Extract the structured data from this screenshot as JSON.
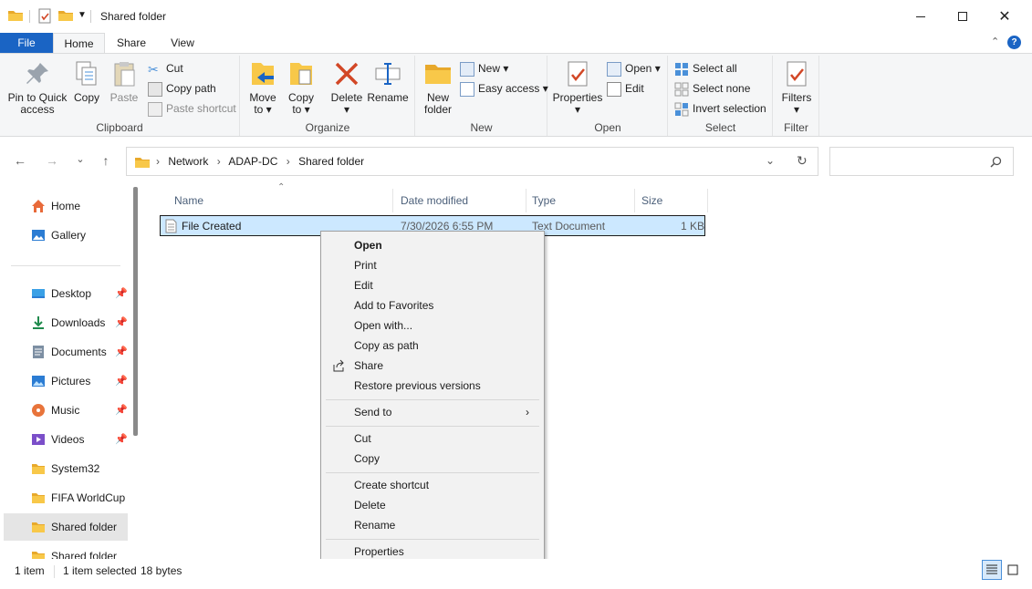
{
  "window": {
    "title": "Shared folder",
    "minimize_icon": "minimize-icon",
    "maximize_icon": "maximize-icon",
    "close_icon": "close-icon"
  },
  "ribbon_tabs": {
    "file": "File",
    "home": "Home",
    "share": "Share",
    "view": "View"
  },
  "ribbon": {
    "clipboard": {
      "label": "Clipboard",
      "pin_line1": "Pin to Quick",
      "pin_line2": "access",
      "copy": "Copy",
      "paste": "Paste",
      "cut": "Cut",
      "copy_path": "Copy path",
      "paste_shortcut": "Paste shortcut"
    },
    "organize": {
      "label": "Organize",
      "move_line1": "Move",
      "move_line2": "to",
      "copy_line1": "Copy",
      "copy_line2": "to",
      "delete": "Delete",
      "rename": "Rename"
    },
    "new": {
      "label": "New",
      "folder_line1": "New",
      "folder_line2": "folder",
      "new_item": "New",
      "easy_access": "Easy access"
    },
    "open": {
      "label": "Open",
      "properties": "Properties",
      "open": "Open",
      "edit": "Edit"
    },
    "select": {
      "label": "Select",
      "select_all": "Select all",
      "select_none": "Select none",
      "invert": "Invert selection"
    },
    "filter": {
      "label": "Filter",
      "filters": "Filters"
    }
  },
  "breadcrumb": [
    "Network",
    "ADAP-DC",
    "Shared folder"
  ],
  "search": {
    "placeholder": ""
  },
  "navpane": {
    "items": [
      {
        "label": "Home",
        "icon": "home-icon",
        "pinned": false
      },
      {
        "label": "Gallery",
        "icon": "gallery-icon",
        "pinned": false
      },
      {
        "label": "Desktop",
        "icon": "desktop-icon",
        "pinned": true
      },
      {
        "label": "Downloads",
        "icon": "download-icon",
        "pinned": true
      },
      {
        "label": "Documents",
        "icon": "documents-icon",
        "pinned": true
      },
      {
        "label": "Pictures",
        "icon": "pictures-icon",
        "pinned": true
      },
      {
        "label": "Music",
        "icon": "music-icon",
        "pinned": true
      },
      {
        "label": "Videos",
        "icon": "videos-icon",
        "pinned": true
      },
      {
        "label": "System32",
        "icon": "folder-icon",
        "pinned": false
      },
      {
        "label": "FIFA WorldCup",
        "icon": "folder-icon",
        "pinned": false
      },
      {
        "label": "Shared folder",
        "icon": "folder-icon",
        "pinned": false,
        "selected": true
      },
      {
        "label": "Shared folder",
        "icon": "folder-icon",
        "pinned": false
      }
    ]
  },
  "columns": {
    "name": "Name",
    "date": "Date modified",
    "type": "Type",
    "size": "Size"
  },
  "files": [
    {
      "name": "File Created",
      "date": "7/30/2026 6:55 PM",
      "type": "Text Document",
      "size": "1 KB"
    }
  ],
  "context_menu": {
    "open": "Open",
    "print": "Print",
    "edit": "Edit",
    "add_favorites": "Add to Favorites",
    "open_with": "Open with...",
    "copy_as_path": "Copy as path",
    "share": "Share",
    "restore": "Restore previous versions",
    "send_to": "Send to",
    "cut": "Cut",
    "copy": "Copy",
    "create_shortcut": "Create shortcut",
    "delete": "Delete",
    "rename": "Rename",
    "properties": "Properties"
  },
  "status": {
    "count": "1 item",
    "selected": "1 item selected",
    "size": "18 bytes"
  },
  "colors": {
    "accent": "#1a64c4",
    "selection": "#cce8ff",
    "folder": "#f8c849"
  }
}
